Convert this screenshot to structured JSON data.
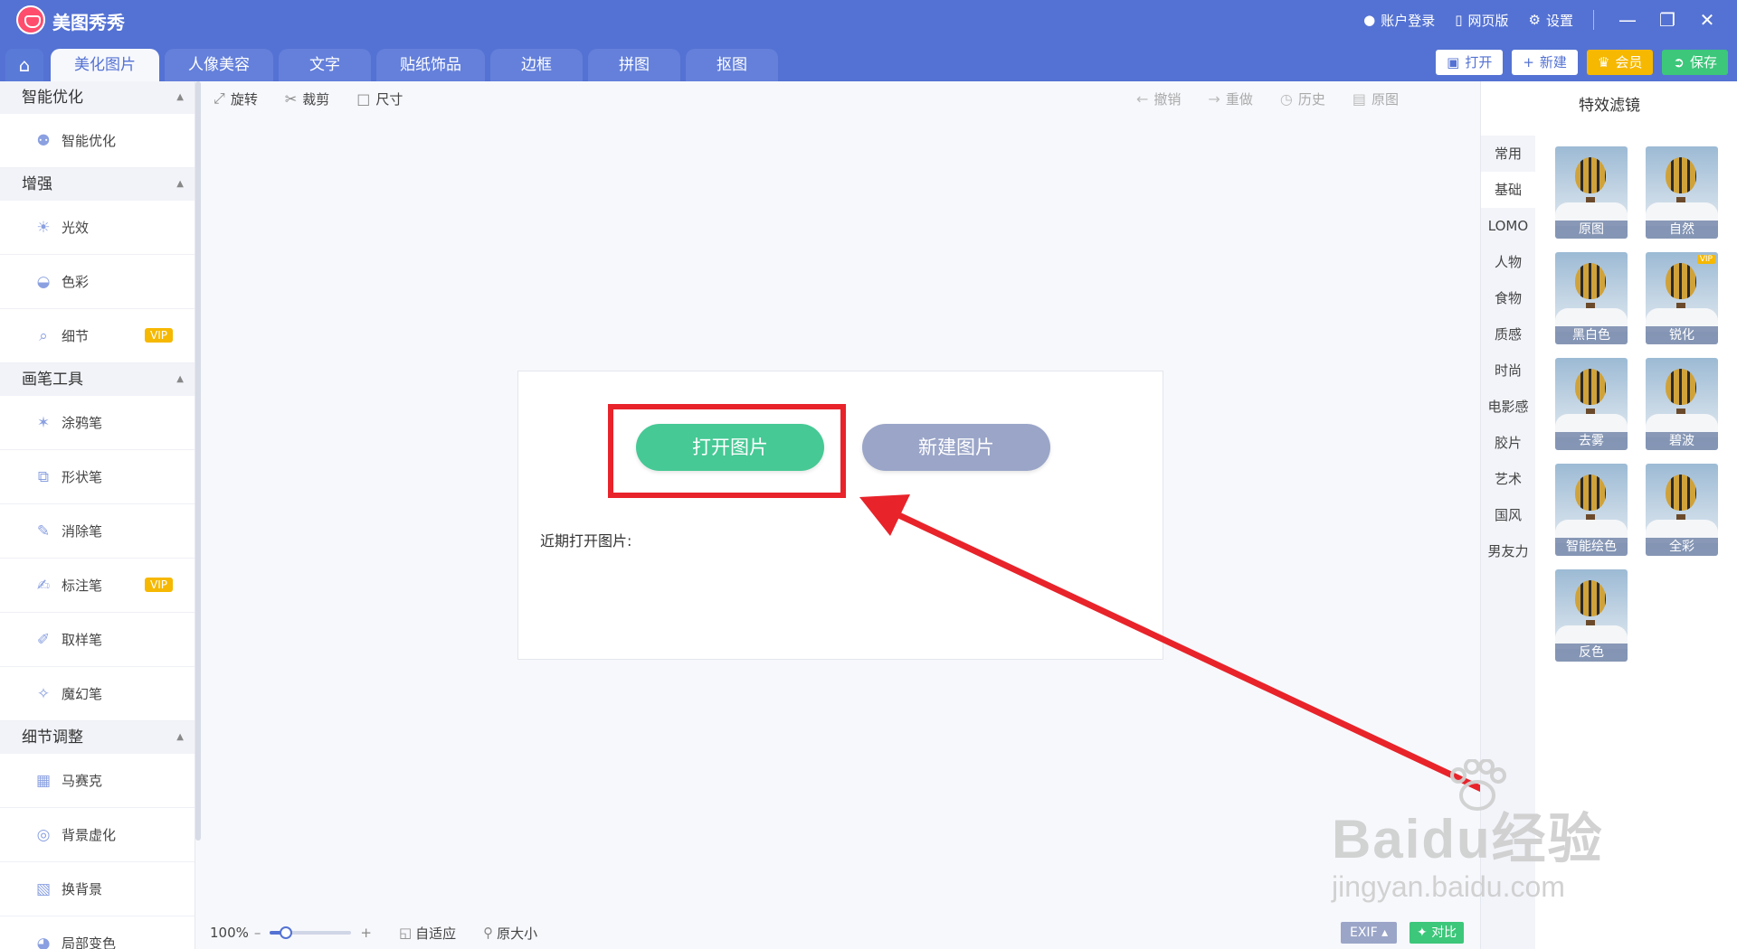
{
  "app": {
    "title": "美图秀秀"
  },
  "titlebar": {
    "account": "账户登录",
    "web_version": "网页版",
    "settings": "设置"
  },
  "tabs": [
    "美化图片",
    "人像美容",
    "文字",
    "贴纸饰品",
    "边框",
    "拼图",
    "抠图"
  ],
  "actions": {
    "open": "打开",
    "new": "新建",
    "vip": "会员",
    "save": "保存"
  },
  "left_panel": {
    "sections": [
      {
        "title": "智能优化",
        "items": [
          {
            "label": "智能优化",
            "icon": "bulb-icon",
            "vip": ""
          }
        ]
      },
      {
        "title": "增强",
        "items": [
          {
            "label": "光效",
            "icon": "sun-icon",
            "vip": ""
          },
          {
            "label": "色彩",
            "icon": "palette-icon",
            "vip": ""
          },
          {
            "label": "细节",
            "icon": "magnifier-icon",
            "vip": "VIP"
          }
        ]
      },
      {
        "title": "画笔工具",
        "items": [
          {
            "label": "涂鸦笔",
            "icon": "doodle-brush-icon",
            "vip": ""
          },
          {
            "label": "形状笔",
            "icon": "shape-brush-icon",
            "vip": ""
          },
          {
            "label": "消除笔",
            "icon": "eraser-brush-icon",
            "vip": ""
          },
          {
            "label": "标注笔",
            "icon": "marker-pen-icon",
            "vip": "VIP"
          },
          {
            "label": "取样笔",
            "icon": "eyedropper-icon",
            "vip": ""
          },
          {
            "label": "魔幻笔",
            "icon": "magic-wand-icon",
            "vip": ""
          }
        ]
      },
      {
        "title": "细节调整",
        "items": [
          {
            "label": "马赛克",
            "icon": "mosaic-icon",
            "vip": ""
          },
          {
            "label": "背景虚化",
            "icon": "blur-icon",
            "vip": ""
          },
          {
            "label": "换背景",
            "icon": "background-icon",
            "vip": ""
          },
          {
            "label": "局部变色",
            "icon": "recolor-icon",
            "vip": ""
          }
        ]
      }
    ]
  },
  "toolbar": {
    "rotate": "旋转",
    "crop": "裁剪",
    "size": "尺寸",
    "undo": "撤销",
    "redo": "重做",
    "history": "历史",
    "original": "原图"
  },
  "canvas": {
    "open_image": "打开图片",
    "new_image": "新建图片",
    "recent_label": "近期打开图片:"
  },
  "right_panel": {
    "title": "特效滤镜",
    "categories": [
      "常用",
      "基础",
      "LOMO",
      "人物",
      "食物",
      "质感",
      "时尚",
      "电影感",
      "胶片",
      "艺术",
      "国风",
      "男友力"
    ],
    "active_category": "基础",
    "filters": [
      {
        "label": "原图",
        "vip": ""
      },
      {
        "label": "自然",
        "vip": ""
      },
      {
        "label": "黑白色",
        "vip": ""
      },
      {
        "label": "锐化",
        "vip": "VIP"
      },
      {
        "label": "去雾",
        "vip": ""
      },
      {
        "label": "碧波",
        "vip": ""
      },
      {
        "label": "智能绘色",
        "vip": ""
      },
      {
        "label": "全彩",
        "vip": ""
      },
      {
        "label": "反色",
        "vip": ""
      }
    ]
  },
  "statusbar": {
    "zoom": "100%",
    "zoom_level": 0.2,
    "fit": "自适应",
    "actual_size": "原大小",
    "exif": "EXIF",
    "compare": "对比"
  },
  "watermark": {
    "brand": "Baidu经验",
    "url": "jingyan.baidu.com"
  },
  "colors": {
    "header": "#5472d3",
    "open_button": "#46c995",
    "new_button": "#9aa5c8",
    "highlight": "#e8232a",
    "vip": "#f6b800",
    "save": "#3cc77a"
  }
}
